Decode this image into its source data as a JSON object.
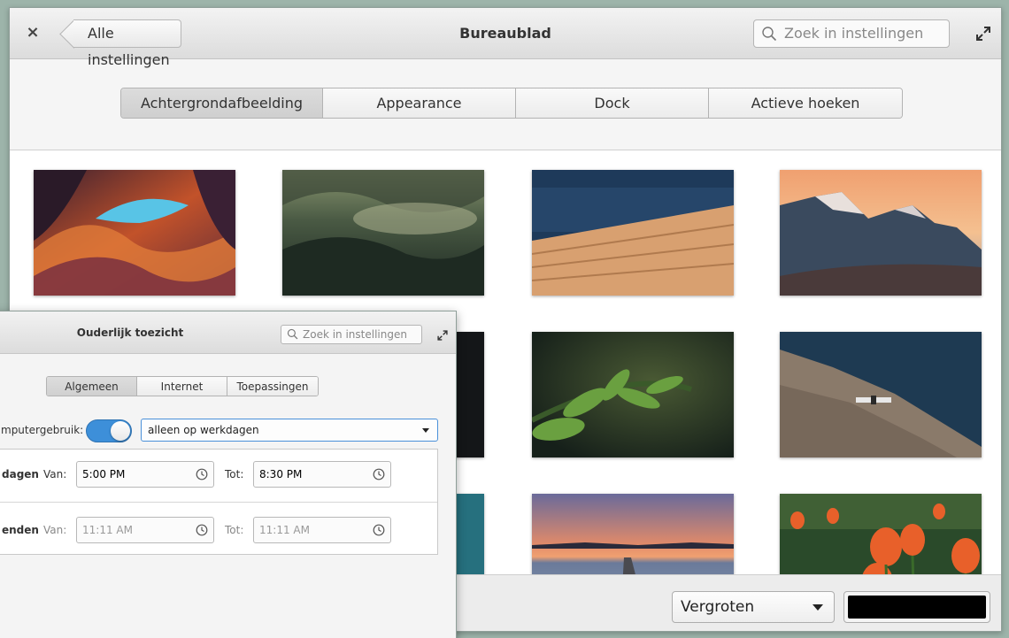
{
  "main_window": {
    "close_label": "×",
    "back_label": "Alle instellingen",
    "title": "Bureaublad",
    "search_placeholder": "Zoek in instellingen",
    "tabs": [
      {
        "label": "Achtergrondafbeelding",
        "active": true
      },
      {
        "label": "Appearance",
        "active": false
      },
      {
        "label": "Dock",
        "active": false
      },
      {
        "label": "Actieve hoeken",
        "active": false
      }
    ],
    "wallpapers": [
      "antelope-canyon",
      "misty-forest",
      "ocean-pier",
      "mountain-sunset",
      "dark-landscape",
      "dark-landscape-2",
      "green-branch",
      "satellite-over-rock",
      "teal-water",
      "teal-water-2",
      "dusk-lake-pier",
      "red-tulips"
    ],
    "footer": {
      "mode_selected": "Vergroten",
      "color_value": "#000000"
    }
  },
  "overlay_window": {
    "title": "Ouderlijk toezicht",
    "search_placeholder": "Zoek in instellingen",
    "tabs": [
      {
        "label": "Algemeen",
        "active": true
      },
      {
        "label": "Internet",
        "active": false
      },
      {
        "label": "Toepassingen",
        "active": false
      }
    ],
    "computer_usage_label": "mputergebruik:",
    "toggle_on": true,
    "schedule_selected": "alleen op werkdagen",
    "rows": [
      {
        "label": "dagen",
        "from_label": "Van:",
        "from_value": "5:00 PM",
        "to_label": "Tot:",
        "to_value": "8:30 PM",
        "enabled": true
      },
      {
        "label": "enden",
        "from_label": "Van:",
        "from_value": "11:11 AM",
        "to_label": "Tot:",
        "to_value": "11:11 AM",
        "enabled": false
      }
    ]
  },
  "colors": {
    "accent": "#3d8fd9",
    "backdrop": "#9db4aa"
  }
}
